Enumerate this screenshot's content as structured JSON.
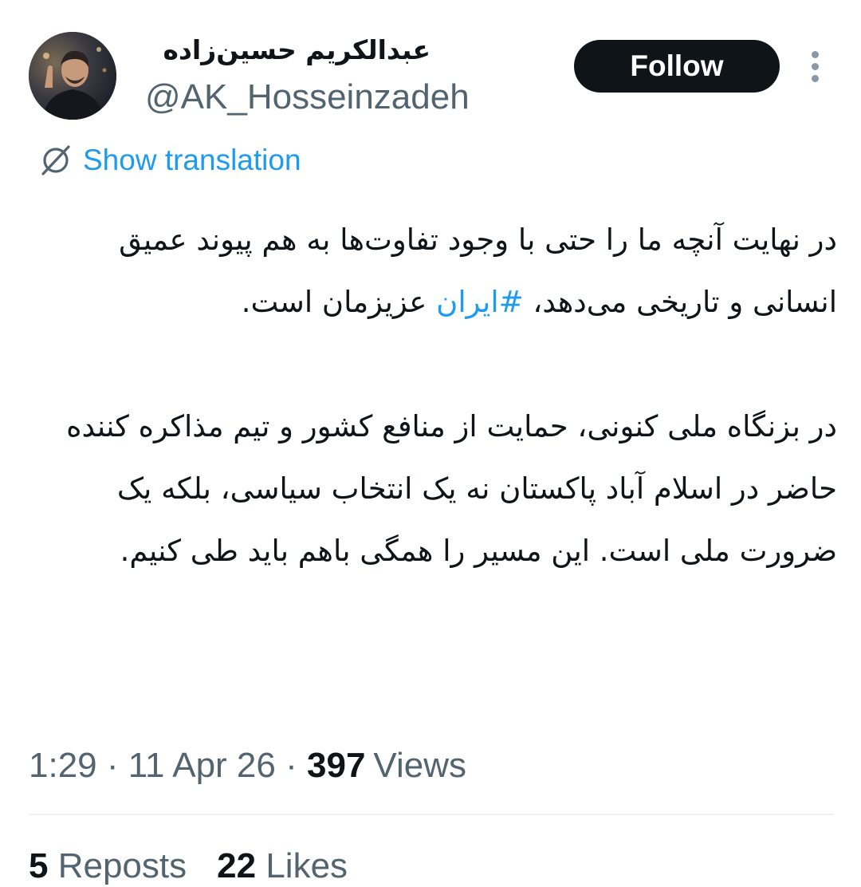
{
  "profile": {
    "display_name": "عبدالکریم حسین‌زاده",
    "handle": "@AK_Hosseinzadeh",
    "follow_label": "Follow"
  },
  "translation": {
    "label": "Show translation",
    "icon": "translate-globe-slash-icon"
  },
  "tweet": {
    "para1_before": "در نهایت آنچه ما را حتی با وجود تفاوت‌ها به هم پیوند عمیق انسانی و تاریخی می‌دهد، ",
    "hashtag": "#ایران",
    "para1_after": " عزیزمان است.",
    "para2": "در بزنگاه ملی کنونی، حمایت از منافع کشور و تیم مذاکره کننده حاضر در اسلام آباد پاکستان نه یک انتخاب سیاسی، بلکه یک ضرورت ملی است. این مسیر را همگی باهم باید طی کنیم."
  },
  "meta": {
    "time": "1:29",
    "separator": "·",
    "date": "11 Apr 26",
    "views_count": "397",
    "views_label": "Views"
  },
  "stats": {
    "reposts_count": "5",
    "reposts_label": "Reposts",
    "likes_count": "22",
    "likes_label": "Likes"
  },
  "colors": {
    "accent": "#1d9bf0",
    "text": "#0f1419",
    "muted": "#536471",
    "button": "#0f1419"
  }
}
